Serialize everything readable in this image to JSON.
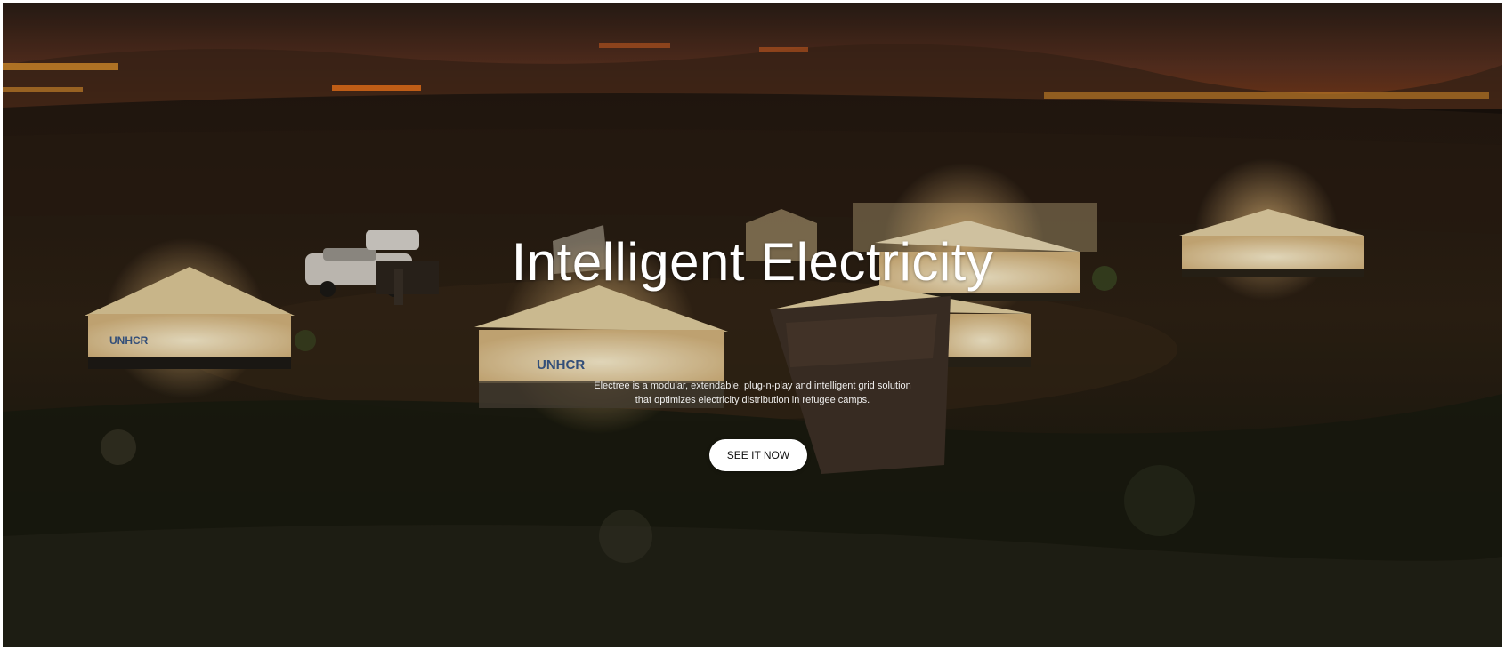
{
  "hero": {
    "title": "Intelligent Electricity",
    "description_line1": "Electree is a modular, extendable, plug-n-play and intelligent grid solution",
    "description_line2": "that optimizes electricity distribution in refugee camps.",
    "cta_label": "SEE IT NOW",
    "tent_logo_text": "UNHCR"
  },
  "colors": {
    "sky": "#3a2418",
    "horizon_glow": "#c4541c",
    "ground": "#22180f",
    "tent_light": "#f3e6c4",
    "button_bg": "#ffffff",
    "text": "#ffffff"
  }
}
